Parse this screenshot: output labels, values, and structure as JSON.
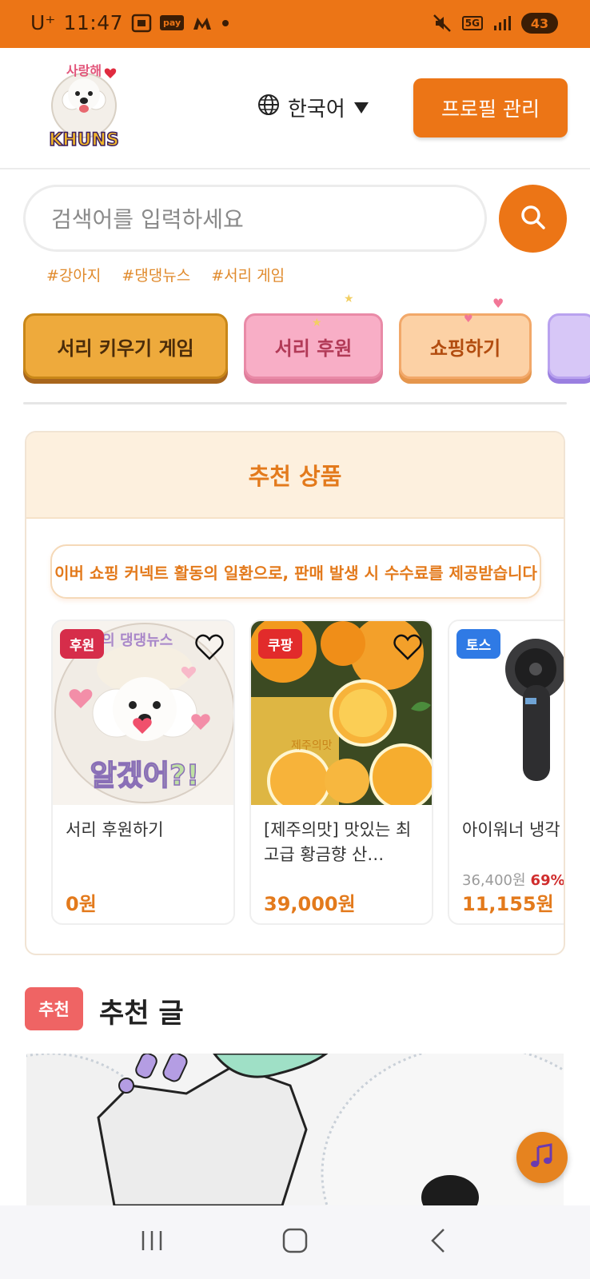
{
  "status_bar": {
    "carrier": "U⁺",
    "time": "11:47",
    "pay_label": "pay",
    "network": "5G",
    "battery": "43"
  },
  "header": {
    "logo_text_top": "사랑해",
    "logo_text_bottom": "KHUNS",
    "language": "한국어",
    "profile_button": "프로필 관리"
  },
  "search": {
    "placeholder": "검색어를 입력하세요",
    "tags": [
      "#강아지",
      "#댕댕뉴스",
      "#서리 게임"
    ]
  },
  "quick_buttons": {
    "game": "서리 키우기 게임",
    "donate": "서리 후원",
    "shop": "쇼핑하기"
  },
  "recommended_products": {
    "title": "추천 상품",
    "disclaimer": "이버 쇼핑 커넥트 활동의 일환으로, 판매 발생 시 수수료를 제공받습니다",
    "items": [
      {
        "badge": "후원",
        "name": "서리 후원하기",
        "original_price": "",
        "discount": "",
        "price": "0원",
        "badge_color": "#d62d4a",
        "image_text": "알겠어?!"
      },
      {
        "badge": "쿠팡",
        "name": "[제주의맛] 맛있는 최고급 황금향 산…",
        "original_price": "",
        "discount": "",
        "price": "39,000원",
        "badge_color": "#e22b2b"
      },
      {
        "badge": "토스",
        "name": "아이워너 냉각 용 선풍기, 블라",
        "original_price": "36,400원",
        "discount": "69%",
        "price": "11,155원",
        "badge_color": "#2f7ae5"
      }
    ]
  },
  "recommended_posts": {
    "badge": "추천",
    "title": "추천 글"
  },
  "colors": {
    "brand": "#ec7516",
    "accent_text": "#e37a1c"
  }
}
